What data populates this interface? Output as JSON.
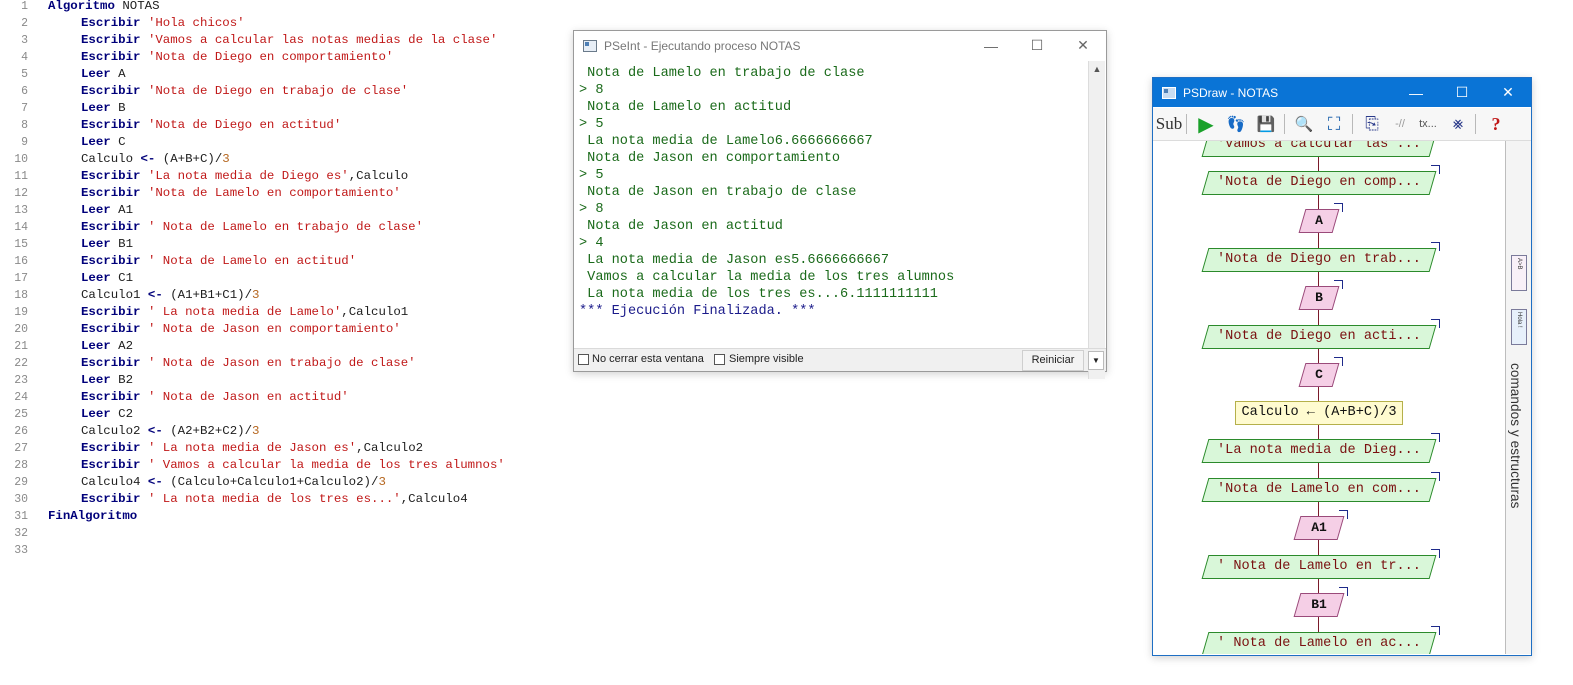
{
  "editor": {
    "lines": [
      {
        "n": "1",
        "indent": 0,
        "tokens": [
          {
            "t": "kw",
            "v": "Algoritmo"
          },
          {
            "t": "plain",
            "v": " NOTAS"
          }
        ]
      },
      {
        "n": "2",
        "indent": 1,
        "tokens": [
          {
            "t": "kw",
            "v": "Escribir"
          },
          {
            "t": "plain",
            "v": " "
          },
          {
            "t": "str",
            "v": "'Hola chicos'"
          }
        ]
      },
      {
        "n": "3",
        "indent": 1,
        "tokens": [
          {
            "t": "kw",
            "v": "Escribir"
          },
          {
            "t": "plain",
            "v": " "
          },
          {
            "t": "str",
            "v": "'Vamos a calcular las notas medias de la clase'"
          }
        ]
      },
      {
        "n": "4",
        "indent": 1,
        "tokens": [
          {
            "t": "kw",
            "v": "Escribir"
          },
          {
            "t": "plain",
            "v": " "
          },
          {
            "t": "str",
            "v": "'Nota de Diego en comportamiento'"
          }
        ]
      },
      {
        "n": "5",
        "indent": 1,
        "tokens": [
          {
            "t": "kw",
            "v": "Leer"
          },
          {
            "t": "plain",
            "v": " A"
          }
        ]
      },
      {
        "n": "6",
        "indent": 1,
        "tokens": [
          {
            "t": "kw",
            "v": "Escribir"
          },
          {
            "t": "plain",
            "v": " "
          },
          {
            "t": "str",
            "v": "'Nota de Diego en trabajo de clase'"
          }
        ]
      },
      {
        "n": "7",
        "indent": 1,
        "tokens": [
          {
            "t": "kw",
            "v": "Leer"
          },
          {
            "t": "plain",
            "v": " B"
          }
        ]
      },
      {
        "n": "8",
        "indent": 1,
        "tokens": [
          {
            "t": "kw",
            "v": "Escribir"
          },
          {
            "t": "plain",
            "v": " "
          },
          {
            "t": "str",
            "v": "'Nota de Diego en actitud'"
          }
        ]
      },
      {
        "n": "9",
        "indent": 1,
        "tokens": [
          {
            "t": "kw",
            "v": "Leer"
          },
          {
            "t": "plain",
            "v": " C"
          }
        ]
      },
      {
        "n": "10",
        "indent": 1,
        "tokens": [
          {
            "t": "plain",
            "v": "Calculo "
          },
          {
            "t": "kw",
            "v": "<-"
          },
          {
            "t": "plain",
            "v": " (A+B+C)/"
          },
          {
            "t": "num",
            "v": "3"
          }
        ]
      },
      {
        "n": "11",
        "indent": 1,
        "tokens": [
          {
            "t": "kw",
            "v": "Escribir"
          },
          {
            "t": "plain",
            "v": " "
          },
          {
            "t": "str",
            "v": "'La nota media de Diego es'"
          },
          {
            "t": "plain",
            "v": ",Calculo"
          }
        ]
      },
      {
        "n": "12",
        "indent": 1,
        "tokens": [
          {
            "t": "kw",
            "v": "Escribir"
          },
          {
            "t": "plain",
            "v": " "
          },
          {
            "t": "str",
            "v": "'Nota de Lamelo en comportamiento'"
          }
        ]
      },
      {
        "n": "13",
        "indent": 1,
        "tokens": [
          {
            "t": "kw",
            "v": "Leer"
          },
          {
            "t": "plain",
            "v": " A1"
          }
        ]
      },
      {
        "n": "14",
        "indent": 1,
        "tokens": [
          {
            "t": "kw",
            "v": "Escribir"
          },
          {
            "t": "plain",
            "v": " "
          },
          {
            "t": "str",
            "v": "' Nota de Lamelo en trabajo de clase'"
          }
        ]
      },
      {
        "n": "15",
        "indent": 1,
        "tokens": [
          {
            "t": "kw",
            "v": "Leer"
          },
          {
            "t": "plain",
            "v": " B1"
          }
        ]
      },
      {
        "n": "16",
        "indent": 1,
        "tokens": [
          {
            "t": "kw",
            "v": "Escribir"
          },
          {
            "t": "plain",
            "v": " "
          },
          {
            "t": "str",
            "v": "' Nota de Lamelo en actitud'"
          }
        ]
      },
      {
        "n": "17",
        "indent": 1,
        "tokens": [
          {
            "t": "kw",
            "v": "Leer"
          },
          {
            "t": "plain",
            "v": " C1"
          }
        ]
      },
      {
        "n": "18",
        "indent": 1,
        "tokens": [
          {
            "t": "plain",
            "v": "Calculo1 "
          },
          {
            "t": "kw",
            "v": "<-"
          },
          {
            "t": "plain",
            "v": " (A1+B1+C1)/"
          },
          {
            "t": "num",
            "v": "3"
          }
        ]
      },
      {
        "n": "19",
        "indent": 1,
        "tokens": [
          {
            "t": "kw",
            "v": "Escribir"
          },
          {
            "t": "plain",
            "v": " "
          },
          {
            "t": "str",
            "v": "' La nota media de Lamelo'"
          },
          {
            "t": "plain",
            "v": ",Calculo1"
          }
        ]
      },
      {
        "n": "20",
        "indent": 1,
        "tokens": [
          {
            "t": "kw",
            "v": "Escribir"
          },
          {
            "t": "plain",
            "v": " "
          },
          {
            "t": "str",
            "v": "' Nota de Jason en comportamiento'"
          }
        ]
      },
      {
        "n": "21",
        "indent": 1,
        "tokens": [
          {
            "t": "kw",
            "v": "Leer"
          },
          {
            "t": "plain",
            "v": " A2"
          }
        ]
      },
      {
        "n": "22",
        "indent": 1,
        "tokens": [
          {
            "t": "kw",
            "v": "Escribir"
          },
          {
            "t": "plain",
            "v": " "
          },
          {
            "t": "str",
            "v": "' Nota de Jason en trabajo de clase'"
          }
        ]
      },
      {
        "n": "23",
        "indent": 1,
        "tokens": [
          {
            "t": "kw",
            "v": "Leer"
          },
          {
            "t": "plain",
            "v": " B2"
          }
        ]
      },
      {
        "n": "24",
        "indent": 1,
        "tokens": [
          {
            "t": "kw",
            "v": "Escribir"
          },
          {
            "t": "plain",
            "v": " "
          },
          {
            "t": "str",
            "v": "' Nota de Jason en actitud'"
          }
        ]
      },
      {
        "n": "25",
        "indent": 1,
        "tokens": [
          {
            "t": "kw",
            "v": "Leer"
          },
          {
            "t": "plain",
            "v": " C2"
          }
        ]
      },
      {
        "n": "26",
        "indent": 1,
        "tokens": [
          {
            "t": "plain",
            "v": "Calculo2 "
          },
          {
            "t": "kw",
            "v": "<-"
          },
          {
            "t": "plain",
            "v": " (A2+B2+C2)/"
          },
          {
            "t": "num",
            "v": "3"
          }
        ]
      },
      {
        "n": "27",
        "indent": 1,
        "tokens": [
          {
            "t": "kw",
            "v": "Escribir"
          },
          {
            "t": "plain",
            "v": " "
          },
          {
            "t": "str",
            "v": "' La nota media de Jason es'"
          },
          {
            "t": "plain",
            "v": ",Calculo2"
          }
        ]
      },
      {
        "n": "28",
        "indent": 1,
        "tokens": [
          {
            "t": "kw",
            "v": "Escribir"
          },
          {
            "t": "plain",
            "v": " "
          },
          {
            "t": "str",
            "v": "' Vamos a calcular la media de los tres alumnos'"
          }
        ]
      },
      {
        "n": "29",
        "indent": 1,
        "tokens": [
          {
            "t": "plain",
            "v": "Calculo4 "
          },
          {
            "t": "kw",
            "v": "<-"
          },
          {
            "t": "plain",
            "v": " (Calculo+Calculo1+Calculo2)/"
          },
          {
            "t": "num",
            "v": "3"
          }
        ]
      },
      {
        "n": "30",
        "indent": 1,
        "tokens": [
          {
            "t": "kw",
            "v": "Escribir"
          },
          {
            "t": "plain",
            "v": " "
          },
          {
            "t": "str",
            "v": "' La nota media de los tres es...'"
          },
          {
            "t": "plain",
            "v": ",Calculo4"
          }
        ]
      },
      {
        "n": "31",
        "indent": 0,
        "tokens": [
          {
            "t": "kw",
            "v": "FinAlgoritmo"
          }
        ]
      },
      {
        "n": "32",
        "indent": 0,
        "tokens": []
      },
      {
        "n": "33",
        "indent": 0,
        "tokens": []
      }
    ]
  },
  "pseint": {
    "title": "PSeInt - Ejecutando proceso NOTAS",
    "minimize_glyph": "—",
    "maximize_glyph": "☐",
    "close_glyph": "✕",
    "console": [
      {
        "kind": "out",
        "text": " Nota de Lamelo en trabajo de clase"
      },
      {
        "kind": "in",
        "text": "> 8"
      },
      {
        "kind": "out",
        "text": " Nota de Lamelo en actitud"
      },
      {
        "kind": "in",
        "text": "> 5"
      },
      {
        "kind": "out",
        "text": " La nota media de Lamelo6.6666666667"
      },
      {
        "kind": "out",
        "text": " Nota de Jason en comportamiento"
      },
      {
        "kind": "in",
        "text": "> 5"
      },
      {
        "kind": "out",
        "text": " Nota de Jason en trabajo de clase"
      },
      {
        "kind": "in",
        "text": "> 8"
      },
      {
        "kind": "out",
        "text": " Nota de Jason en actitud"
      },
      {
        "kind": "in",
        "text": "> 4"
      },
      {
        "kind": "out",
        "text": " La nota media de Jason es5.6666666667"
      },
      {
        "kind": "out",
        "text": " Vamos a calcular la media de los tres alumnos"
      },
      {
        "kind": "out",
        "text": " La nota media de los tres es...6.1111111111"
      },
      {
        "kind": "fin",
        "text": "*** Ejecución Finalizada. ***"
      }
    ],
    "footer": {
      "no_close_label": "No cerrar esta ventana",
      "always_visible_label": "Siempre visible",
      "restart_label": "Reiniciar"
    }
  },
  "psdraw": {
    "title": "PSDraw - NOTAS",
    "minimize_glyph": "—",
    "maximize_glyph": "☐",
    "close_glyph": "✕",
    "toolbar": {
      "sub_label": "Sub",
      "run_glyph": "▶",
      "step_glyph": "👣",
      "save_glyph": "💾",
      "zoom_glyph": "🔍",
      "fit_glyph": "⛶",
      "export_glyph": "⎘",
      "text_label": "tx...",
      "comment_label": "-//",
      "help_glyph": "?"
    },
    "side_panel_label": "comandos y estructuras",
    "side_minis": [
      "A>B",
      "Hola !"
    ],
    "flow": [
      {
        "kind": "out",
        "text": "'Vamos a calcular las ..."
      },
      {
        "kind": "out",
        "text": "'Nota de Diego en comp..."
      },
      {
        "kind": "in",
        "text": "A"
      },
      {
        "kind": "out",
        "text": "'Nota de Diego en trab..."
      },
      {
        "kind": "in",
        "text": "B"
      },
      {
        "kind": "out",
        "text": "'Nota de Diego en acti..."
      },
      {
        "kind": "in",
        "text": "C"
      },
      {
        "kind": "proc",
        "text": "Calculo ← (A+B+C)/3"
      },
      {
        "kind": "out",
        "text": "'La nota media de Dieg..."
      },
      {
        "kind": "out",
        "text": "'Nota de Lamelo en com..."
      },
      {
        "kind": "in",
        "text": "A1"
      },
      {
        "kind": "out",
        "text": "' Nota de Lamelo en tr..."
      },
      {
        "kind": "in",
        "text": "B1"
      },
      {
        "kind": "out",
        "text": "' Nota de Lamelo en ac..."
      }
    ]
  },
  "colors": {
    "keyword": "#00007a",
    "string": "#c01818",
    "console_output": "#1a6a1a",
    "psdraw_titlebar": "#0a74d6",
    "flow_output_fill": "#d9f7d9",
    "flow_input_fill": "#f5cfe6",
    "flow_process_fill": "#fffbd0"
  }
}
